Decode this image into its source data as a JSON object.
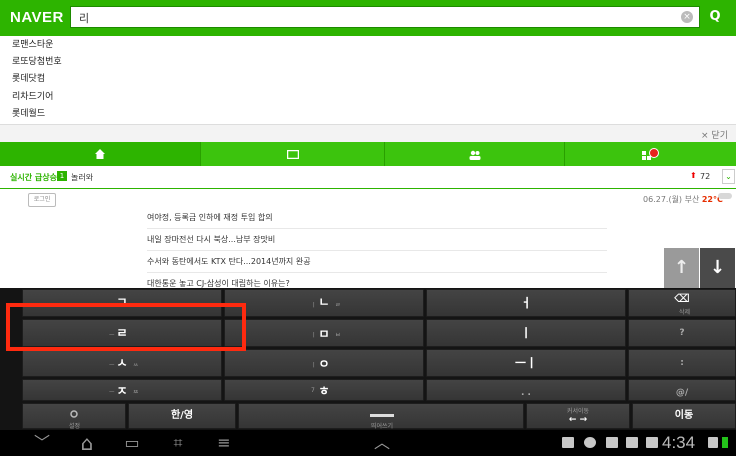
{
  "naver": {
    "logo": "NAVER",
    "search_value": "리",
    "search_btn": "Q",
    "clear_btn": "×"
  },
  "suggestions": [
    "로맨스타운",
    "로또당첨번호",
    "롯데닷컴",
    "리차드기어",
    "롯데월드"
  ],
  "close_label": "× 닫기",
  "realtime": {
    "label": "실시간 급상승",
    "rank": "1",
    "keyword": "놀러와",
    "trend": "⬆",
    "change": "72",
    "more": "⌄"
  },
  "login_label": "로그인",
  "weather": {
    "date": "06.27.(월) 부산",
    "temp": "22°C"
  },
  "news": [
    "여야정, 등록금 인하에 재정 투입 합의",
    "내일 장마전선 다시 북상...남부 장맛비",
    "수서와 동탄에서도 KTX 탄다...2014년까지 완공",
    "대한통운 놓고 CJ-삼성이 대립하는 이유는?"
  ],
  "arrows": {
    "up": "↑",
    "down": "↓"
  },
  "keyboard": {
    "rows": [
      [
        {
          "main": "ㄱ",
          "sub_left": "ㅡ",
          "sub_right": "ㄲ",
          "sub_top": "",
          "sub_bottom": "1"
        },
        {
          "main": "ㄴ",
          "sub_left": "ㅣ",
          "sub_right": "ㄹ",
          "sub_top": "",
          "sub_bottom": "2"
        },
        {
          "main": "ㅓ",
          "sub_left": "",
          "sub_right": "",
          "sub_top": "",
          "sub_bottom": ""
        },
        {
          "main": "⌫",
          "sub_left": "",
          "sub_right": "",
          "sub_top": "",
          "sub_bottom": "삭제"
        }
      ],
      [
        {
          "main": "ㄹ",
          "sub_left": "ㅡ",
          "sub_right": "ㄹ",
          "sub_top": "",
          "sub_bottom": ""
        },
        {
          "main": "ㅁ",
          "sub_left": "ㅣ",
          "sub_right": "ㅂ",
          "sub_top": "ㅂ",
          "sub_bottom": ""
        },
        {
          "main": "ㅣ",
          "sub_left": "",
          "sub_right": "",
          "sub_top": "",
          "sub_bottom": ""
        },
        {
          "main": "?",
          "sub_left": "",
          "sub_right": "",
          "sub_top": "",
          "sub_bottom": ""
        }
      ],
      [
        {
          "main": "ㅅ",
          "sub_left": "ㅡ",
          "sub_right": "ㅆ",
          "sub_top": "",
          "sub_bottom": "3"
        },
        {
          "main": "ㅇ",
          "sub_left": "ㅣ",
          "sub_right": "",
          "sub_top": "ㅇ",
          "sub_bottom": "4"
        },
        {
          "main": "ㅡㅣ",
          "sub_left": "",
          "sub_right": "",
          "sub_top": "",
          "sub_bottom": ""
        },
        {
          "main": ":",
          "sub_left": "",
          "sub_right": "",
          "sub_top": "",
          "sub_bottom": ""
        }
      ],
      [
        {
          "main": "ㅈ",
          "sub_left": "ㅡ",
          "sub_right": "ㅉ",
          "sub_top": "",
          "sub_bottom": ""
        },
        {
          "main": "ㅎ",
          "sub_left": "ㅣ",
          "sub_right": "",
          "sub_top": "",
          "sub_bottom": "7"
        },
        {
          "main": ". .",
          "sub_left": "",
          "sub_right": "",
          "sub_top": "",
          "sub_bottom": ""
        },
        {
          "main": "@/",
          "sub_left": "",
          "sub_right": "",
          "sub_top": "",
          "sub_bottom": ""
        }
      ]
    ],
    "bottom": {
      "settings": "설정",
      "hangul": "한/영",
      "space": "띄어쓰기",
      "cursor": "← →",
      "cursor_sub": "커서이동",
      "enter": "이동"
    }
  },
  "nav": {
    "back": "﹀",
    "home": "⌂",
    "recent": "▭",
    "screenshot": "⌗",
    "menu": "≡",
    "up": "︿",
    "time": "4:34"
  }
}
